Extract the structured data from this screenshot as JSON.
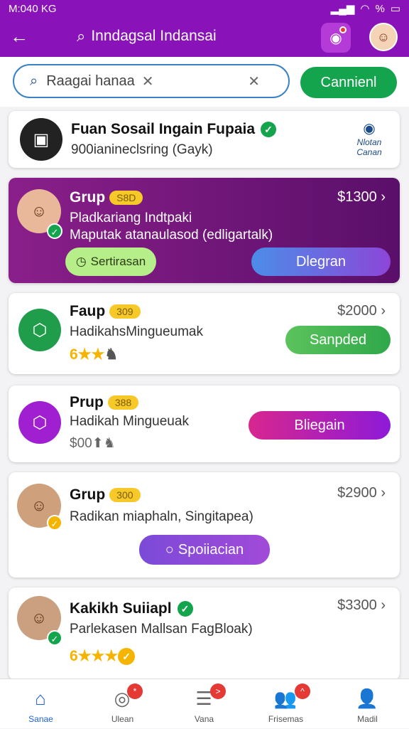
{
  "status": {
    "time": "M:040 KG",
    "battery": "%"
  },
  "header": {
    "title": "Inndagsal Indansai"
  },
  "search": {
    "value": "Raagai hanaa",
    "cancel_label": "Cannienl"
  },
  "cards": [
    {
      "name": "Fuan Sosail Ingain Fupaia",
      "sub": "900ianineclsring (Gayk)",
      "side_label": "Nlotan\nCanan"
    },
    {
      "name": "Grup",
      "badge": "S8D",
      "price": "$1300",
      "line1": "Pladkariang Indtpaki",
      "line2": "Maputak atanaulasod (edligartalk)",
      "chip": "Sertirasan",
      "button": "Dlegran"
    },
    {
      "name": "Faup",
      "badge": "309",
      "price": "$2000",
      "sub": "HadikahsMingueumak",
      "rating": "6",
      "button": "Sanpded"
    },
    {
      "name": "Prup",
      "badge": "388",
      "sub": "Hadikah Mingueuak",
      "price_note": "$00",
      "button": "Bliegain"
    },
    {
      "name": "Grup",
      "badge": "300",
      "price": "$2900",
      "sub": "Radikan miaphaln, Singitapea)",
      "button": "Spoiiacian"
    },
    {
      "name": "Kakikh Suiiapl",
      "price": "$3300",
      "sub": "Parlekasen Mallsan FagBloak)",
      "rating": "6"
    }
  ],
  "nav": [
    {
      "label": "Sanae",
      "icon": "home-icon",
      "active": true
    },
    {
      "label": "Ulean",
      "icon": "target-icon",
      "badge": "*"
    },
    {
      "label": "Vana",
      "icon": "list-icon",
      "badge": ">"
    },
    {
      "label": "Frisemas",
      "icon": "people-icon",
      "badge": "^"
    },
    {
      "label": "Madil",
      "icon": "profile-icon"
    }
  ],
  "colors": {
    "accent": "#8a12b9",
    "green": "#14a44d",
    "gold": "#f7c928"
  }
}
